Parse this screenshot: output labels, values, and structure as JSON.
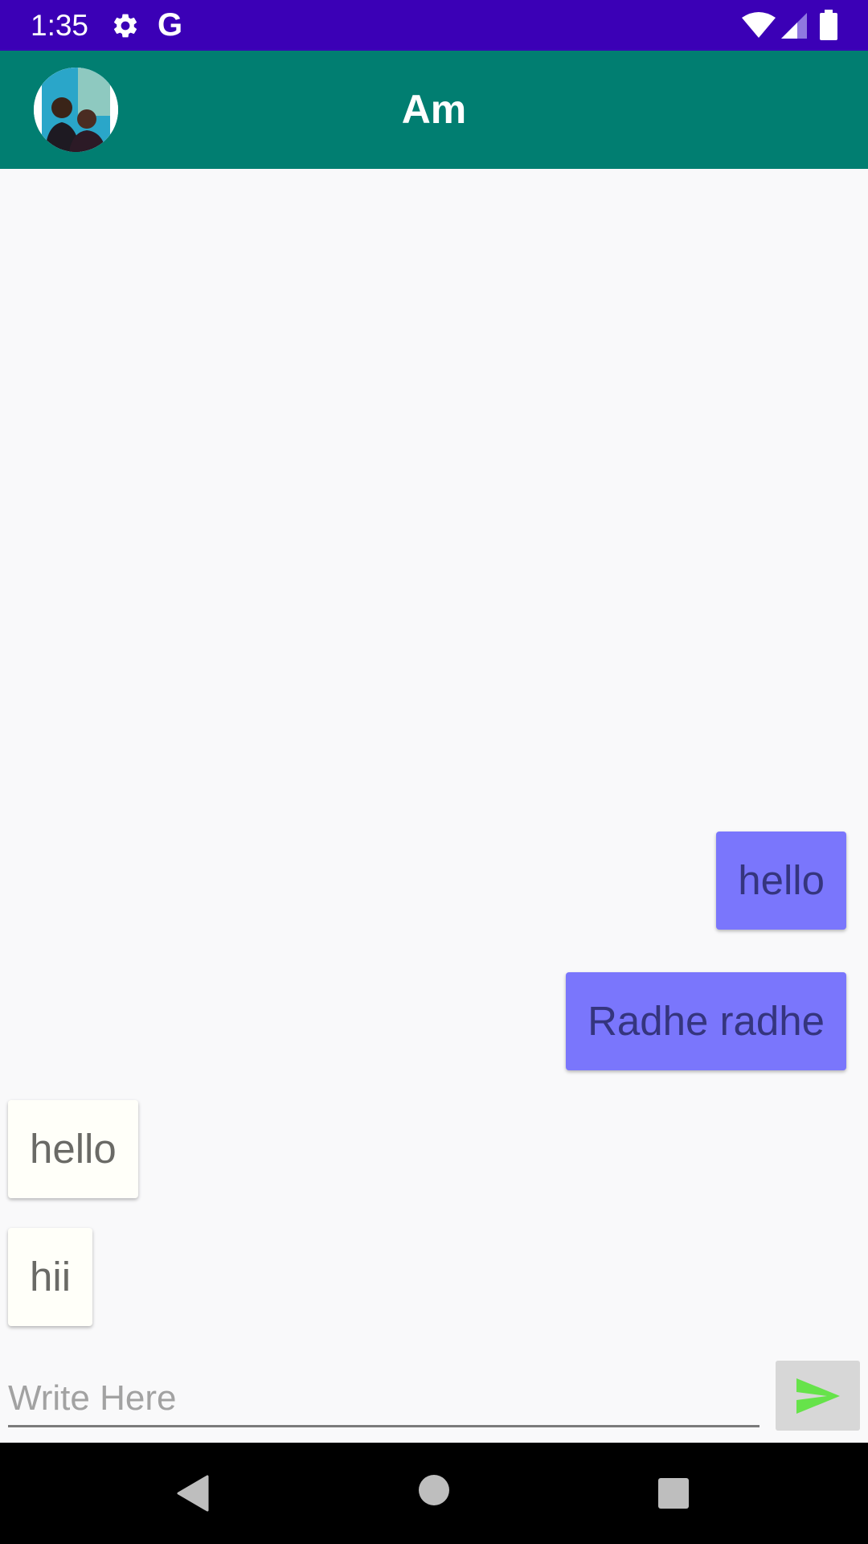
{
  "status_bar": {
    "time": "1:35",
    "g_label": "G",
    "icons": [
      "gear-icon",
      "wifi-icon",
      "signal-icon",
      "battery-icon"
    ],
    "background_color": "#3b00b6"
  },
  "app_bar": {
    "title": "Am",
    "avatar": "avatar-photo",
    "background_color": "#017e71"
  },
  "messages": [
    {
      "text": "hello",
      "type": "sent"
    },
    {
      "text": "Radhe radhe",
      "type": "sent"
    },
    {
      "text": "hello",
      "type": "received"
    },
    {
      "text": "hii",
      "type": "received"
    }
  ],
  "composer": {
    "placeholder": "Write Here",
    "value": "",
    "send_icon": "send-icon",
    "send_icon_color": "#66e34a"
  },
  "colors": {
    "sent_bubble": "#7a76fc",
    "received_bubble": "#fffff9",
    "background": "#f9f9fa"
  },
  "nav_bar": {
    "icons": [
      "back-icon",
      "home-icon",
      "recents-icon"
    ]
  }
}
